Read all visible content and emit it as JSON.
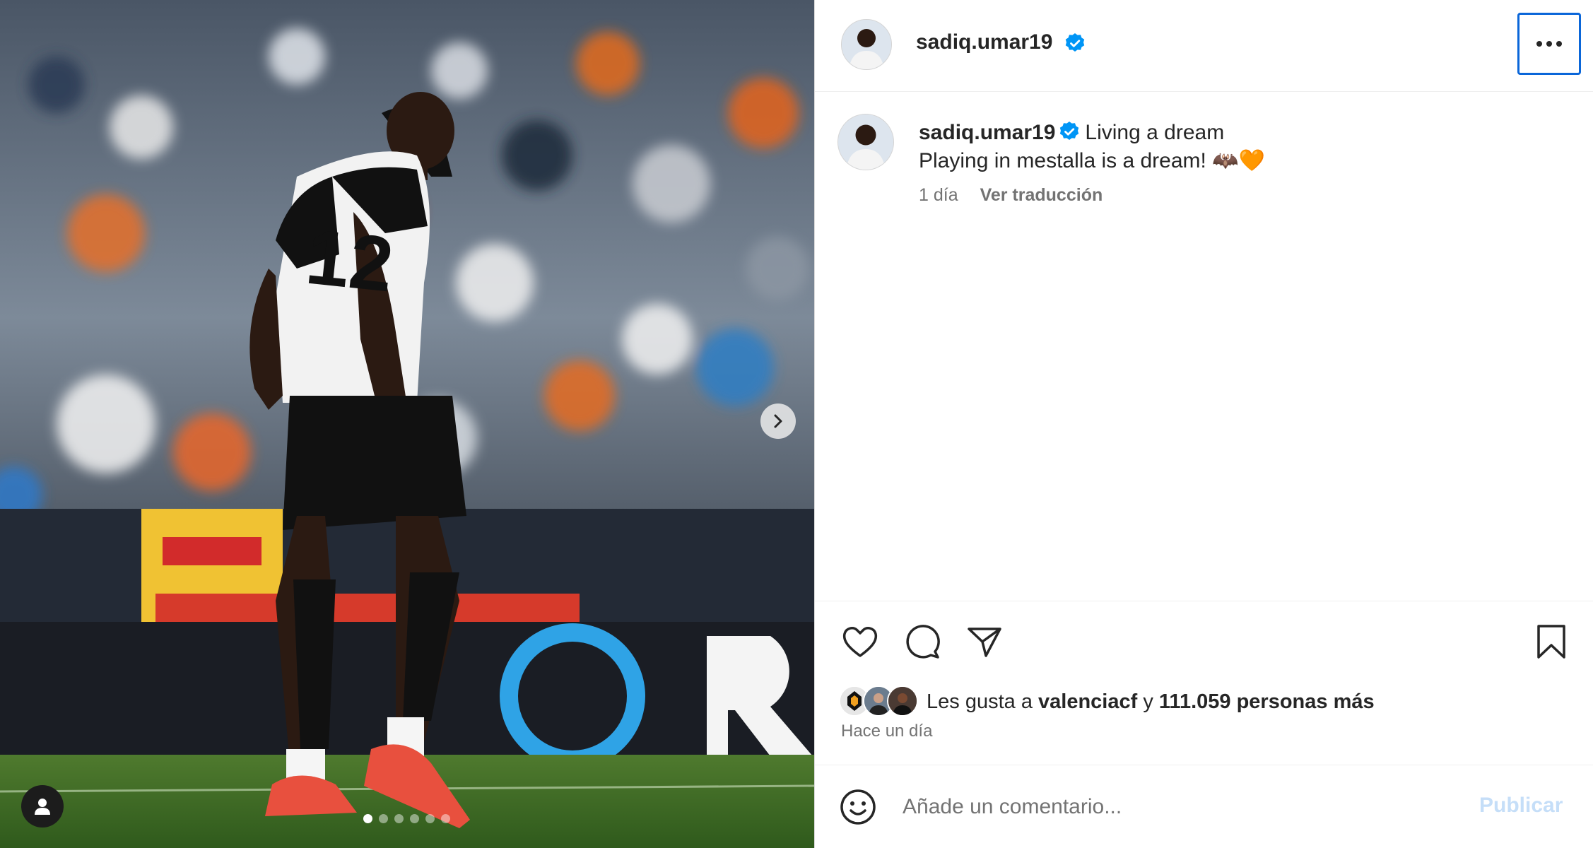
{
  "post": {
    "author": "sadiq.umar19",
    "verified": true,
    "more_icon": "more-horizontal-icon",
    "caption_title": "Living a dream",
    "caption_body": "Playing in mestalla is a dream! 🦇🧡",
    "time_short": "1 día",
    "translate_label": "Ver traducción"
  },
  "media": {
    "slides_total": 6,
    "active_slide": 1,
    "next_icon": "chevron-right-icon",
    "tag_icon": "user-icon",
    "jersey_number": "12"
  },
  "actions": {
    "like_icon": "heart-icon",
    "comment_icon": "comment-icon",
    "share_icon": "send-icon",
    "save_icon": "bookmark-icon"
  },
  "likes": {
    "prefix": "Les gusta a",
    "first_liker": "valenciacf",
    "connector": "y",
    "others": "111.059 personas más"
  },
  "time_ago": "Hace un día",
  "comment": {
    "emoji_icon": "smiley-icon",
    "placeholder": "Añade un comentario...",
    "publish_label": "Publicar"
  },
  "colors": {
    "accent_blue": "#0095f6",
    "publish_disabled": "#c5def8",
    "focus_border": "#0a66d9",
    "secondary_text": "#737373"
  }
}
